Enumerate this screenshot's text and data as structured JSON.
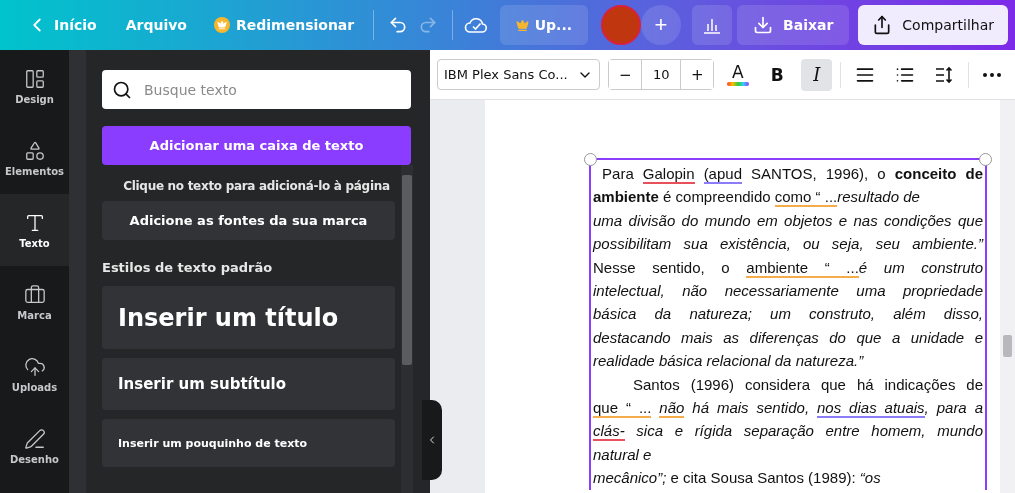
{
  "topbar": {
    "home_label": "Início",
    "file_label": "Arquivo",
    "resize_label": "Redimensionar",
    "history": [
      {
        "kind": "undo",
        "disabled": false
      },
      {
        "kind": "redo",
        "disabled": true
      }
    ],
    "upgrade_label": "Up...",
    "download_label": "Baixar",
    "share_label": "Compartilhar",
    "add_member": "+"
  },
  "rail": [
    {
      "kind": "design",
      "label": "Design",
      "selected": false
    },
    {
      "kind": "elements",
      "label": "Elementos",
      "selected": false
    },
    {
      "kind": "text",
      "label": "Texto",
      "selected": true
    },
    {
      "kind": "brand",
      "label": "Marca",
      "selected": false
    },
    {
      "kind": "uploads",
      "label": "Uploads",
      "selected": false
    },
    {
      "kind": "draw",
      "label": "Desenho",
      "selected": false
    }
  ],
  "panel": {
    "search": {
      "placeholder": "Busque texto"
    },
    "add_button": "Adicionar uma caixa de texto",
    "hint": "Clique no texto para adicioná-lo à página",
    "brand_button": "Adicione as fontes da sua marca",
    "section_title": "Estilos de texto padrão",
    "styles": [
      {
        "kind": "title",
        "label": "Inserir um título"
      },
      {
        "kind": "subtitle",
        "label": "Inserir um subtítulo"
      },
      {
        "kind": "body",
        "label": "Inserir um pouquinho de texto"
      }
    ]
  },
  "toolbar": {
    "font": "IBM Plex Sans Co...",
    "decrease": "−",
    "font_size": "10",
    "increase": "+",
    "color_label": "A",
    "format": [
      {
        "kind": "bold",
        "label": "B",
        "selected": false
      },
      {
        "kind": "italic",
        "label": "I",
        "selected": true
      }
    ]
  },
  "document": {
    "lines": [
      {
        "justify": true,
        "indent": false,
        "segments": [
          {
            "text": " Para "
          },
          {
            "text": "Galopin ",
            "color": "#e8505b"
          },
          {
            "text": "(apud",
            "color": "#8c7cf8"
          },
          {
            "text": " SANTOS, 1996), o **conceito de**"
          }
        ]
      },
      {
        "justify": false,
        "indent": false,
        "segments": [
          {
            "text": "**ambiente** é compreendido "
          },
          {
            "text": "como “ ...",
            "color": "#f5ad4c"
          },
          {
            "text": "*resultado de*"
          }
        ]
      },
      {
        "justify": true,
        "indent": false,
        "segments": [
          {
            "text": "*uma divisão do mundo em objetos e nas condições que*"
          }
        ]
      },
      {
        "justify": true,
        "indent": false,
        "segments": [
          {
            "text": "*possibilitam sua existência, ou seja, seu ambiente.”*"
          }
        ]
      },
      {
        "justify": true,
        "indent": false,
        "segments": [
          {
            "text": "Nesse sentido, o "
          },
          {
            "text": "ambiente “ ...",
            "color": "#f5ad4c"
          },
          {
            "text": "*é um construto*"
          }
        ]
      },
      {
        "justify": true,
        "indent": false,
        "segments": [
          {
            "text": "*intelectual, não necessariamente uma propriedade*"
          }
        ]
      },
      {
        "justify": true,
        "indent": false,
        "segments": [
          {
            "text": "*básica da natureza; um construto, além disso,*"
          }
        ]
      },
      {
        "justify": true,
        "indent": false,
        "segments": [
          {
            "text": "*destacando mais as diferenças do que a unidade e*"
          }
        ]
      },
      {
        "justify": false,
        "indent": false,
        "segments": [
          {
            "text": "*realidade básica relacional da natureza.”*"
          }
        ]
      },
      {
        "justify": true,
        "indent": true,
        "segments": [
          {
            "text": "Santos (1996) considera que há indicações de"
          }
        ]
      },
      {
        "justify": true,
        "indent": false,
        "segments": [
          {
            "text": "que “ ... ",
            "color": "#f5ad4c"
          },
          {
            "text": "*não*",
            "color": "#f5ad4c"
          },
          {
            "text": " *há mais sentido,* "
          },
          {
            "text": "*nos dias atuais*",
            "color": "#8c7cf8"
          },
          {
            "text": "*, para a*"
          }
        ]
      },
      {
        "justify": true,
        "indent": false,
        "segments": [
          {
            "text": "*clás-*",
            "color": "#e8505b"
          },
          {
            "text": " *sica e rígida separação entre homem, mundo*"
          }
        ]
      },
      {
        "justify": false,
        "indent": false,
        "segments": [
          {
            "text": "*natural e*"
          }
        ]
      },
      {
        "justify": false,
        "indent": false,
        "segments": [
          {
            "text": "*mecânico”;* e cita Sousa Santos (1989): *“os*"
          }
        ]
      }
    ]
  }
}
